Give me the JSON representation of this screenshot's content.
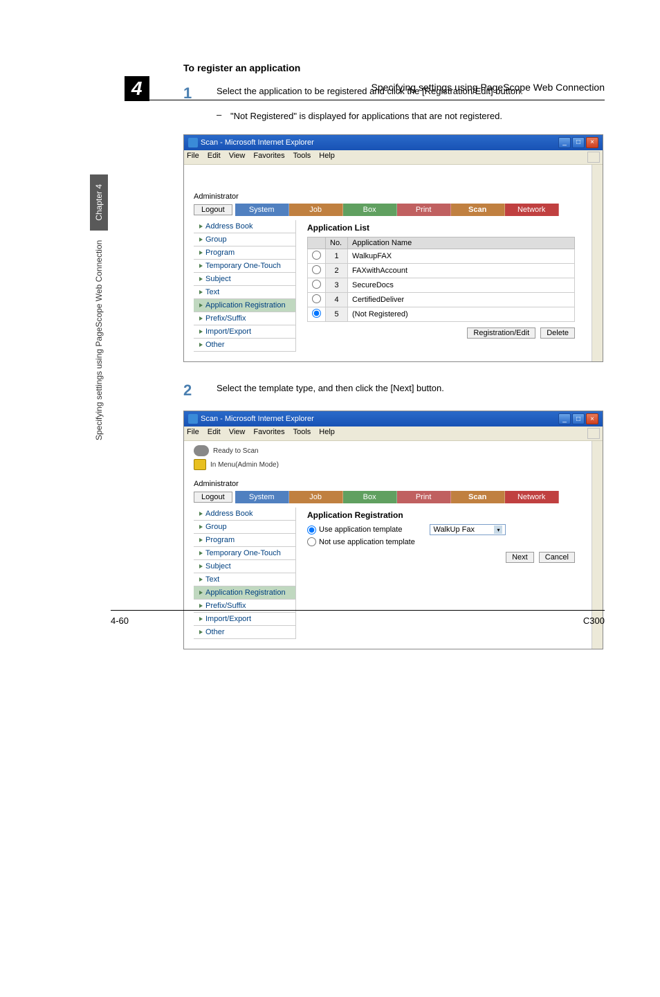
{
  "chapter_number": "4",
  "header_right": "Specifying settings using PageScope Web Connection",
  "section_heading": "To register an application",
  "step1_text": "Select the application to be registered and click the [Registration/Edit] button.",
  "note1_text": "\"Not Registered\" is displayed for applications that are not registered.",
  "step2_text": "Select the template type, and then click the [Next] button.",
  "side_tab_dark": "Chapter 4",
  "side_tab_light": "Specifying settings using PageScope Web Connection",
  "footer_left": "4-60",
  "footer_right": "C300",
  "ie_window": {
    "title": "Scan - Microsoft Internet Explorer",
    "menu": [
      "File",
      "Edit",
      "View",
      "Favorites",
      "Tools",
      "Help"
    ],
    "status_ready": "Ready to Scan",
    "status_admin": "In Menu(Admin Mode)",
    "admin_label": "Administrator",
    "logout": "Logout",
    "tabs": {
      "system": "System",
      "job": "Job",
      "box": "Box",
      "print": "Print",
      "scan": "Scan",
      "network": "Network"
    },
    "sidebar": [
      "Address Book",
      "Group",
      "Program",
      "Temporary One-Touch",
      "Subject",
      "Text",
      "Application Registration",
      "Prefix/Suffix",
      "Import/Export",
      "Other"
    ]
  },
  "screenshot1": {
    "panel_title": "Application List",
    "col_no": "No.",
    "col_name": "Application Name",
    "rows": [
      {
        "no": "1",
        "name": "WalkupFAX",
        "selected": false
      },
      {
        "no": "2",
        "name": "FAXwithAccount",
        "selected": false
      },
      {
        "no": "3",
        "name": "SecureDocs",
        "selected": false
      },
      {
        "no": "4",
        "name": "CertifiedDeliver",
        "selected": false
      },
      {
        "no": "5",
        "name": "(Not Registered)",
        "selected": true
      }
    ],
    "btn_reg": "Registration/Edit",
    "btn_del": "Delete"
  },
  "screenshot2": {
    "panel_title": "Application Registration",
    "opt_use": "Use application template",
    "opt_not": "Not use application template",
    "dropdown": "WalkUp Fax",
    "btn_next": "Next",
    "btn_cancel": "Cancel"
  }
}
